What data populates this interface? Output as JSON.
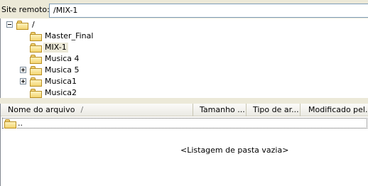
{
  "site_bar": {
    "label": "Site remoto:",
    "path": "/MIX-1"
  },
  "tree": {
    "root_label": "/",
    "items": [
      {
        "label": "Master_Final",
        "expander": "none",
        "selected": false
      },
      {
        "label": "MIX-1",
        "expander": "none",
        "selected": true
      },
      {
        "label": "Musica 4",
        "expander": "none",
        "selected": false
      },
      {
        "label": "Musica 5",
        "expander": "plus",
        "selected": false
      },
      {
        "label": "Musica1",
        "expander": "plus",
        "selected": false
      },
      {
        "label": "Musica2",
        "expander": "none",
        "selected": false
      }
    ]
  },
  "file_list": {
    "columns": {
      "name": "Nome do arquivo",
      "sort_indicator": "/",
      "size": "Tamanho ...",
      "type": "Tipo de ar...",
      "modified": "Modificado pel..."
    },
    "parent_entry": "..",
    "empty_message": "<Listagem de pasta vazia>"
  }
}
